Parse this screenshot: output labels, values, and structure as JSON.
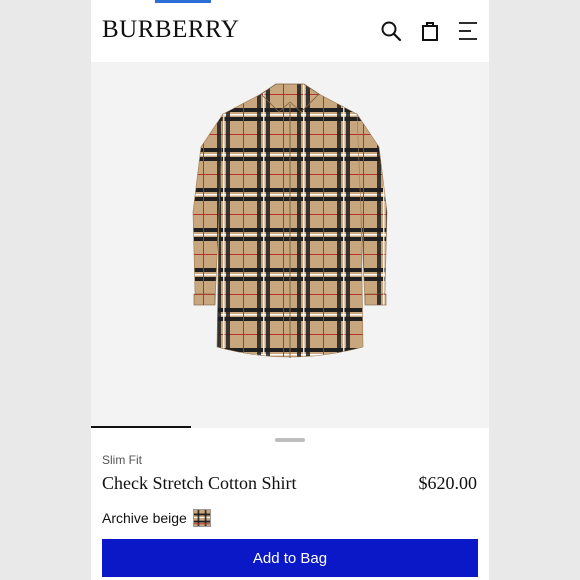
{
  "brand": "BURBERRY",
  "header": {
    "icons": [
      "search-icon",
      "shopping-bag-icon",
      "menu-icon"
    ]
  },
  "product": {
    "fit": "Slim Fit",
    "name": "Check Stretch Cotton Shirt",
    "price": "$620.00",
    "color_name": "Archive beige"
  },
  "actions": {
    "add_to_bag": "Add to Bag"
  },
  "colors": {
    "accent": "#0a18c7",
    "check_base": "#c8a77e",
    "check_black": "#1f1f1f",
    "check_red": "#b8322c"
  }
}
